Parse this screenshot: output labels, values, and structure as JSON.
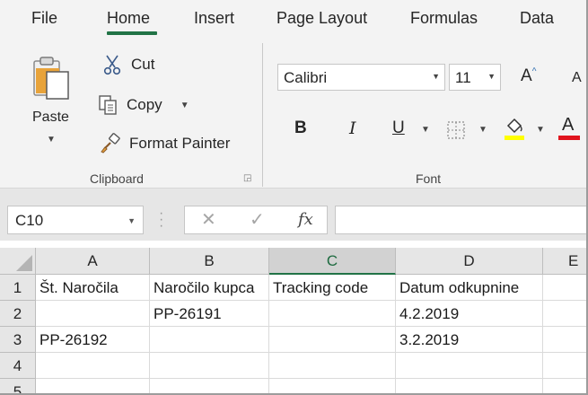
{
  "tabs": [
    "File",
    "Home",
    "Insert",
    "Page Layout",
    "Formulas",
    "Data"
  ],
  "active_tab": "Home",
  "clipboard": {
    "paste_label": "Paste",
    "cut_label": "Cut",
    "copy_label": "Copy",
    "format_painter_label": "Format Painter",
    "group_label": "Clipboard"
  },
  "font": {
    "font_name": "Calibri",
    "font_size": "11",
    "group_label": "Font",
    "bold": "B",
    "italic": "I",
    "underline": "U",
    "font_color": "A",
    "grow_font": "A",
    "shrink_font": "A",
    "highlight_color": "#ffff00",
    "font_color_value": "#e0141e"
  },
  "formula_bar": {
    "name_box": "C10",
    "fx": "fx",
    "cancel": "✕",
    "enter": "✓",
    "value": ""
  },
  "accent_color": "#217346",
  "sheet": {
    "columns": [
      "A",
      "B",
      "C",
      "D",
      "E"
    ],
    "selected_column": "C",
    "rows": [
      "1",
      "2",
      "3",
      "4",
      "5"
    ],
    "cells": [
      [
        "Št. Naročila",
        "Naročilo kupca",
        "Tracking code",
        "Datum odkupnine",
        ""
      ],
      [
        "",
        "PP-26191",
        "",
        "4.2.2019",
        ""
      ],
      [
        "PP-26192",
        "",
        "",
        "3.2.2019",
        ""
      ],
      [
        "",
        "",
        "",
        "",
        ""
      ],
      [
        "",
        "",
        "",
        "",
        ""
      ]
    ]
  }
}
